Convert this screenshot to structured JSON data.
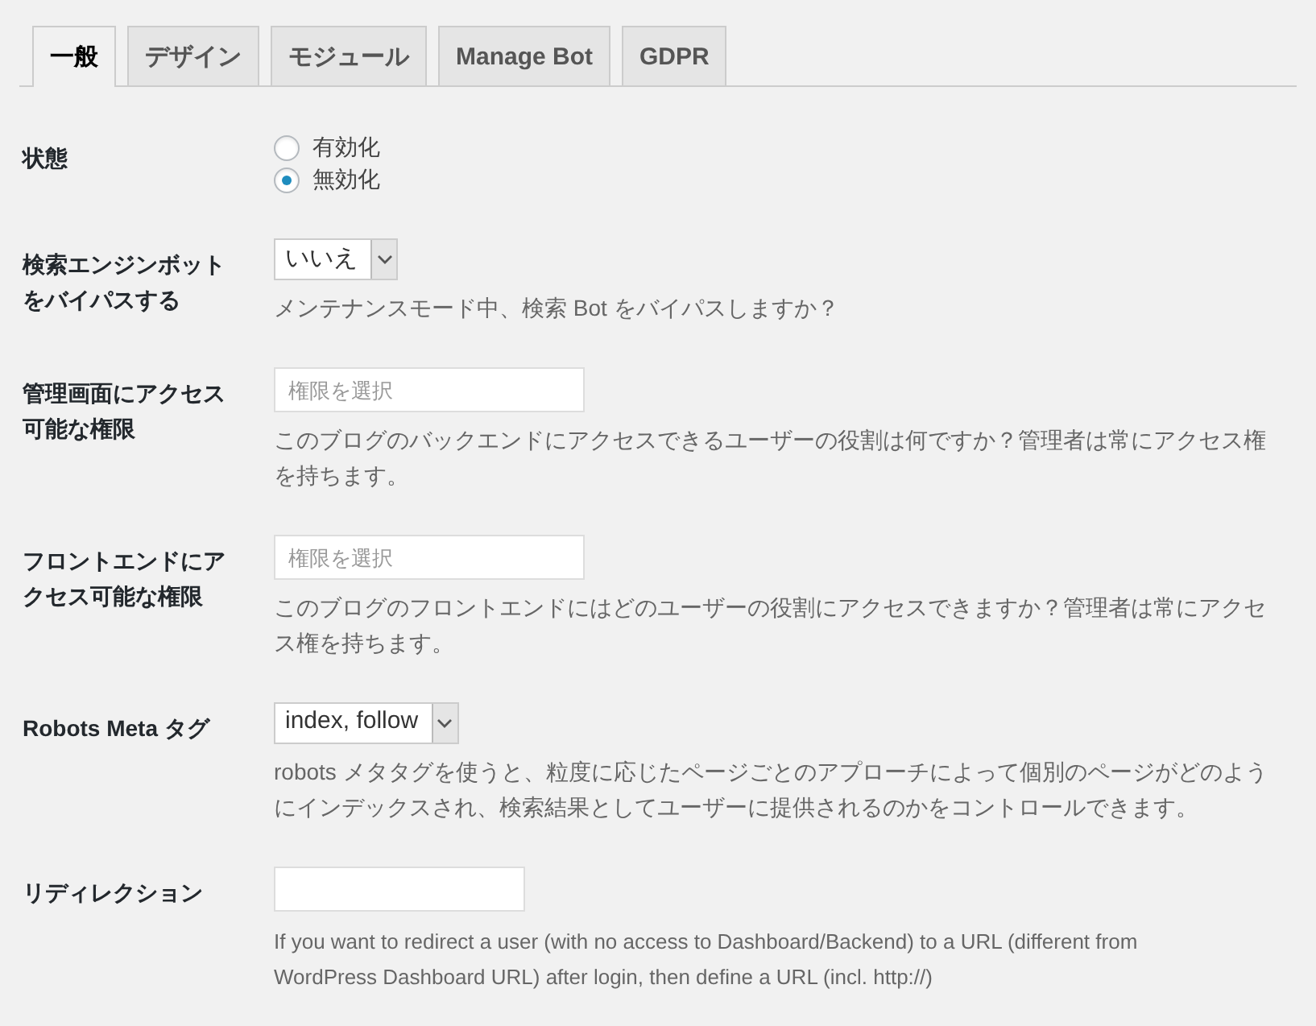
{
  "tabs": [
    {
      "label": "一般",
      "selected": true
    },
    {
      "label": "デザイン",
      "selected": false
    },
    {
      "label": "モジュール",
      "selected": false
    },
    {
      "label": "Manage Bot",
      "selected": false
    },
    {
      "label": "GDPR",
      "selected": false
    }
  ],
  "settings": [
    {
      "kind": "radio",
      "label": "状態",
      "options": [
        {
          "label": "有効化",
          "selected": false
        },
        {
          "label": "無効化",
          "selected": true
        }
      ]
    },
    {
      "kind": "select",
      "label": "検索エンジンボットをバイパスする",
      "value": "いいえ",
      "description": "メンテナンスモード中、検索 Bot をバイパスしますか？"
    },
    {
      "kind": "multiselect",
      "label": "管理画面にアクセス可能な権限",
      "placeholder": "権限を選択",
      "description": "このブログのバックエンドにアクセスできるユーザーの役割は何ですか？管理者は常にアクセス権を持ちます。"
    },
    {
      "kind": "multiselect",
      "label": "フロントエンドにアクセス可能な権限",
      "placeholder": "権限を選択",
      "description": "このブログのフロントエンドにはどのユーザーの役割にアクセスできますか？管理者は常にアクセス権を持ちます。"
    },
    {
      "kind": "select",
      "label": "Robots Meta タグ",
      "value": "index, follow",
      "description": "robots メタタグを使うと、粒度に応じたページごとのアプローチによって個別のページがどのようにインデックスされ、検索結果としてユーザーに提供されるのかをコントロールできます。"
    },
    {
      "kind": "text",
      "label": "リディレクション",
      "description": "If you want to redirect a user (with no access to Dashboard/Backend) to a URL (different from WordPress Dashboard URL) after login, then define a URL (incl. http://)"
    }
  ]
}
